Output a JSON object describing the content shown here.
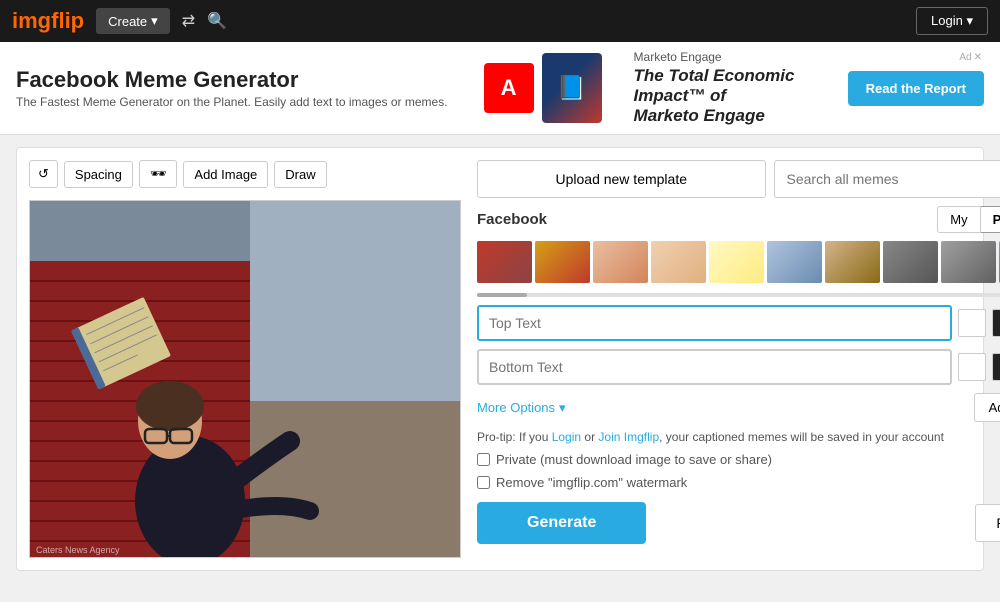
{
  "navbar": {
    "logo_img": "img",
    "logo_text": "flip",
    "create_label": "Create",
    "login_label": "Login"
  },
  "ad": {
    "marketo_label": "Marketo Engage",
    "headline": "The Total Economic Impact™ of",
    "subheadline": "Marketo Engage",
    "read_btn": "Read the Report",
    "adobe_logo": "A",
    "close_x": "✕",
    "ad_choice": "Ad"
  },
  "page": {
    "title": "Facebook Meme Generator",
    "subtitle": "The Fastest Meme Generator on the Planet. Easily add text to images or memes."
  },
  "toolbar": {
    "refresh_icon": "↺",
    "spacing_label": "Spacing",
    "glasses_icon": "🕶",
    "add_image_label": "Add Image",
    "draw_label": "Draw"
  },
  "right_panel": {
    "upload_label": "Upload new template",
    "search_placeholder": "Search all memes",
    "template_title": "Facebook",
    "my_tab": "My",
    "popular_tab": "Popular",
    "top_text_placeholder": "Top Text",
    "bottom_text_placeholder": "Bottom Text",
    "more_options": "More Options",
    "add_text_label": "Add Text",
    "pro_tip_prefix": "Pro-tip: If you ",
    "pro_tip_link1": "Login",
    "pro_tip_middle": " or ",
    "pro_tip_link2": "Join Imgflip",
    "pro_tip_suffix": ", your captioned memes will be saved in your account",
    "private_label": "Private (must download image to save or share)",
    "watermark_label": "Remove \"imgflip.com\" watermark",
    "generate_label": "Generate",
    "reset_label": "Reset"
  },
  "photo_credit": "Caters News Agency"
}
